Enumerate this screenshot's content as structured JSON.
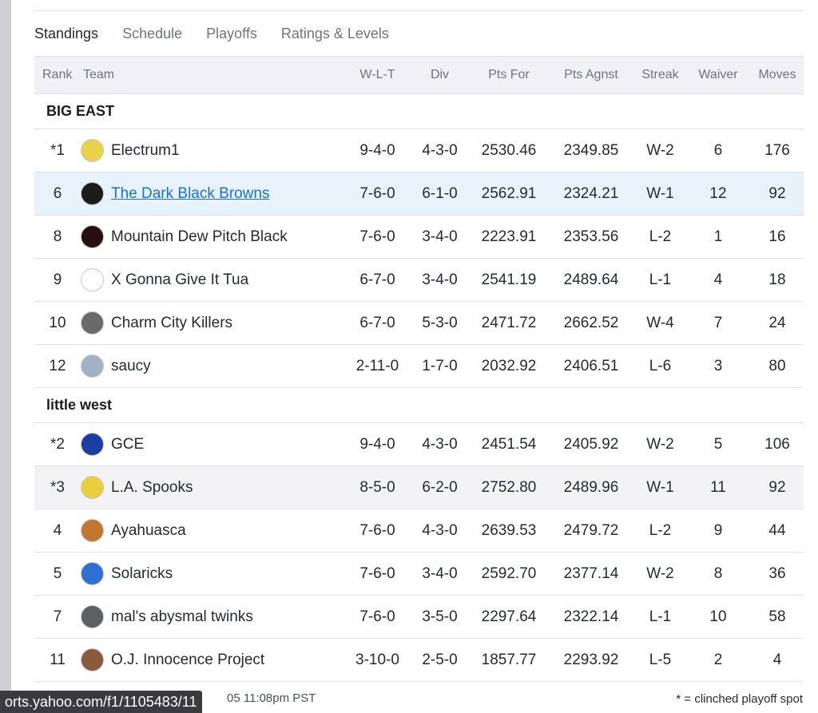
{
  "tabs": [
    "Standings",
    "Schedule",
    "Playoffs",
    "Ratings & Levels"
  ],
  "columns": {
    "rank": "Rank",
    "team": "Team",
    "wlt": "W-L-T",
    "div": "Div",
    "pts_for": "Pts For",
    "pts_agnst": "Pts Agnst",
    "streak": "Streak",
    "waiver": "Waiver",
    "moves": "Moves"
  },
  "divisions": [
    {
      "name": "BIG EAST",
      "teams": [
        {
          "rank": "*1",
          "name": "Electrum1",
          "wlt": "9-4-0",
          "div": "4-3-0",
          "pts_for": "2530.46",
          "pts_agnst": "2349.85",
          "streak": "W-2",
          "waiver": "6",
          "moves": "176",
          "logo_icon": "ram-helmet-icon",
          "logo_color": "#e7d24a"
        },
        {
          "rank": "6",
          "name": "The Dark Black Browns",
          "wlt": "7-6-0",
          "div": "6-1-0",
          "pts_for": "2562.91",
          "pts_agnst": "2324.21",
          "streak": "W-1",
          "waiver": "12",
          "moves": "92",
          "logo_icon": "player-photo-icon",
          "logo_color": "#1c1c1c"
        },
        {
          "rank": "8",
          "name": "Mountain Dew Pitch Black",
          "wlt": "7-6-0",
          "div": "3-4-0",
          "pts_for": "2223.91",
          "pts_agnst": "2353.56",
          "streak": "L-2",
          "waiver": "1",
          "moves": "16",
          "logo_icon": "dew-logo-icon",
          "logo_color": "#2a0f12"
        },
        {
          "rank": "9",
          "name": "X Gonna Give It Tua",
          "wlt": "6-7-0",
          "div": "3-4-0",
          "pts_for": "2541.19",
          "pts_agnst": "2489.64",
          "streak": "L-1",
          "waiver": "4",
          "moves": "18",
          "logo_icon": "text-logo-icon",
          "logo_color": "#ffffff"
        },
        {
          "rank": "10",
          "name": "Charm City Killers",
          "wlt": "6-7-0",
          "div": "5-3-0",
          "pts_for": "2471.72",
          "pts_agnst": "2662.52",
          "streak": "W-4",
          "waiver": "7",
          "moves": "24",
          "logo_icon": "city-skyline-icon",
          "logo_color": "#6a6a6a"
        },
        {
          "rank": "12",
          "name": "saucy",
          "wlt": "2-11-0",
          "div": "1-7-0",
          "pts_for": "2032.92",
          "pts_agnst": "2406.51",
          "streak": "L-6",
          "waiver": "3",
          "moves": "80",
          "logo_icon": "cartoon-figure-icon",
          "logo_color": "#9fb3c4"
        }
      ]
    },
    {
      "name": "little west",
      "teams": [
        {
          "rank": "*2",
          "name": "GCE",
          "wlt": "9-4-0",
          "div": "4-3-0",
          "pts_for": "2451.54",
          "pts_agnst": "2405.92",
          "streak": "W-2",
          "waiver": "5",
          "moves": "106",
          "logo_icon": "blue-helmet-icon",
          "logo_color": "#1b3fa0"
        },
        {
          "rank": "*3",
          "name": "L.A. Spooks",
          "wlt": "8-5-0",
          "div": "6-2-0",
          "pts_for": "2752.80",
          "pts_agnst": "2489.96",
          "streak": "W-1",
          "waiver": "11",
          "moves": "92",
          "logo_icon": "green-helmet-icon",
          "logo_color": "#e9cf3b"
        },
        {
          "rank": "4",
          "name": "Ayahuasca",
          "wlt": "7-6-0",
          "div": "4-3-0",
          "pts_for": "2639.53",
          "pts_agnst": "2479.72",
          "streak": "L-2",
          "waiver": "9",
          "moves": "44",
          "logo_icon": "orange-swirl-icon",
          "logo_color": "#c1772e"
        },
        {
          "rank": "5",
          "name": "Solaricks",
          "wlt": "7-6-0",
          "div": "3-4-0",
          "pts_for": "2592.70",
          "pts_agnst": "2377.14",
          "streak": "W-2",
          "waiver": "8",
          "moves": "36",
          "logo_icon": "orange-helmet-icon",
          "logo_color": "#2f6fd1"
        },
        {
          "rank": "7",
          "name": "mal's abysmal twinks",
          "wlt": "7-6-0",
          "div": "3-5-0",
          "pts_for": "2297.64",
          "pts_agnst": "2322.14",
          "streak": "L-1",
          "waiver": "10",
          "moves": "58",
          "logo_icon": "gray-helmet-icon",
          "logo_color": "#5d5f63"
        },
        {
          "rank": "11",
          "name": "O.J. Innocence Project",
          "wlt": "3-10-0",
          "div": "2-5-0",
          "pts_for": "1857.77",
          "pts_agnst": "2293.92",
          "streak": "L-5",
          "waiver": "2",
          "moves": "4",
          "logo_icon": "face-photo-icon",
          "logo_color": "#8a5a3c"
        }
      ]
    }
  ],
  "footer": {
    "status_url": "orts.yahoo.com/f1/1105483/11",
    "updated_text": "05 11:08pm PST",
    "legend_note": "* = clinched playoff spot"
  }
}
